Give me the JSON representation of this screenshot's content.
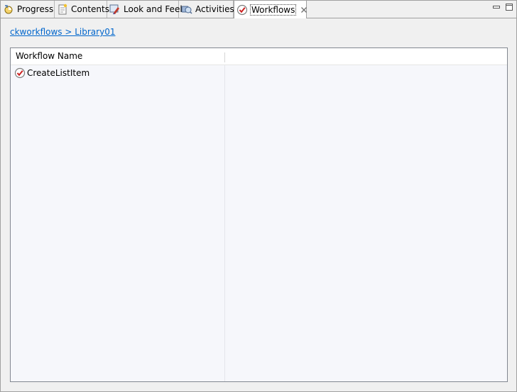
{
  "tabs": [
    {
      "label": "Progress",
      "icon": "progress-icon"
    },
    {
      "label": "Contents",
      "icon": "contents-icon"
    },
    {
      "label": "Look and Feel",
      "icon": "look-and-feel-icon"
    },
    {
      "label": "Activities",
      "icon": "activities-icon"
    },
    {
      "label": "Workflows",
      "icon": "workflows-icon",
      "active": true
    }
  ],
  "window_controls": {
    "minimize": "minimize-icon",
    "maximize": "maximize-icon"
  },
  "breadcrumb": "ckworkflows > Library01",
  "table": {
    "columns": [
      "Workflow Name",
      ""
    ],
    "rows": [
      {
        "name": "CreateListItem",
        "icon": "workflow-icon"
      }
    ]
  },
  "colors": {
    "link": "#0066cc",
    "tab_bar": "#f0f0f0",
    "table_bg": "#f6f7fb",
    "check_red": "#cc2222"
  }
}
